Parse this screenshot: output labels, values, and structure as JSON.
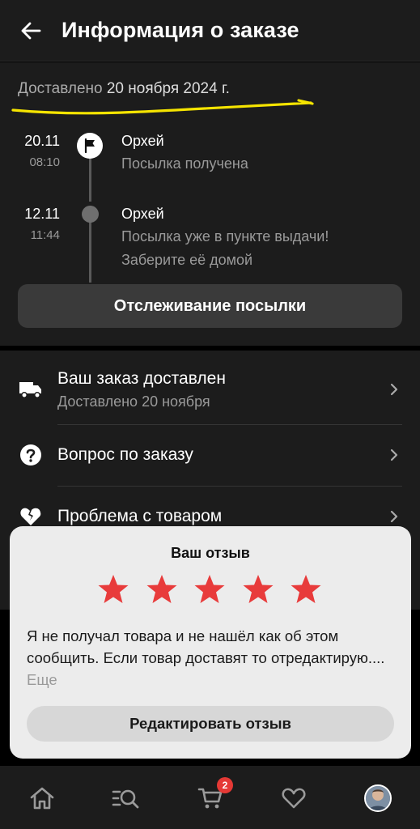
{
  "header": {
    "title": "Информация о заказе"
  },
  "delivery": {
    "prefix": "Доставлено",
    "date": "20 ноября 2024 г.",
    "highlight_color": "#f5e400"
  },
  "timeline": [
    {
      "date": "20.11",
      "time": "08:10",
      "place": "Орхей",
      "status": "Посылка получена",
      "marker": "flag-icon"
    },
    {
      "date": "12.11",
      "time": "11:44",
      "place": "Орхей",
      "status": "Посылка уже в пункте выдачи! Заберите её домой",
      "marker": "dot"
    }
  ],
  "track_button": {
    "label": "Отслеживание посылки"
  },
  "info_items": [
    {
      "title": "Ваш заказ доставлен",
      "subtitle": "Доставлено 20 ноября",
      "icon": "truck-icon"
    },
    {
      "title": "Вопрос по заказу",
      "subtitle": "",
      "icon": "question-icon"
    },
    {
      "title": "Проблема с товаром",
      "subtitle": "",
      "icon": "broken-heart-icon"
    }
  ],
  "review": {
    "title": "Ваш отзыв",
    "rating": 5,
    "max_rating": 5,
    "star_color": "#e83b3b",
    "text": "Я не получал товара и не нашёл как об этом сообщить. Если товар доставят то отредактирую....",
    "more_label": "Еще",
    "edit_button": "Редактировать отзыв"
  },
  "bottom_nav": {
    "items": [
      "home-icon",
      "catalog-search-icon",
      "cart-icon",
      "favorites-heart-icon",
      "profile-avatar"
    ],
    "cart_badge": "2",
    "badge_color": "#e53935"
  }
}
